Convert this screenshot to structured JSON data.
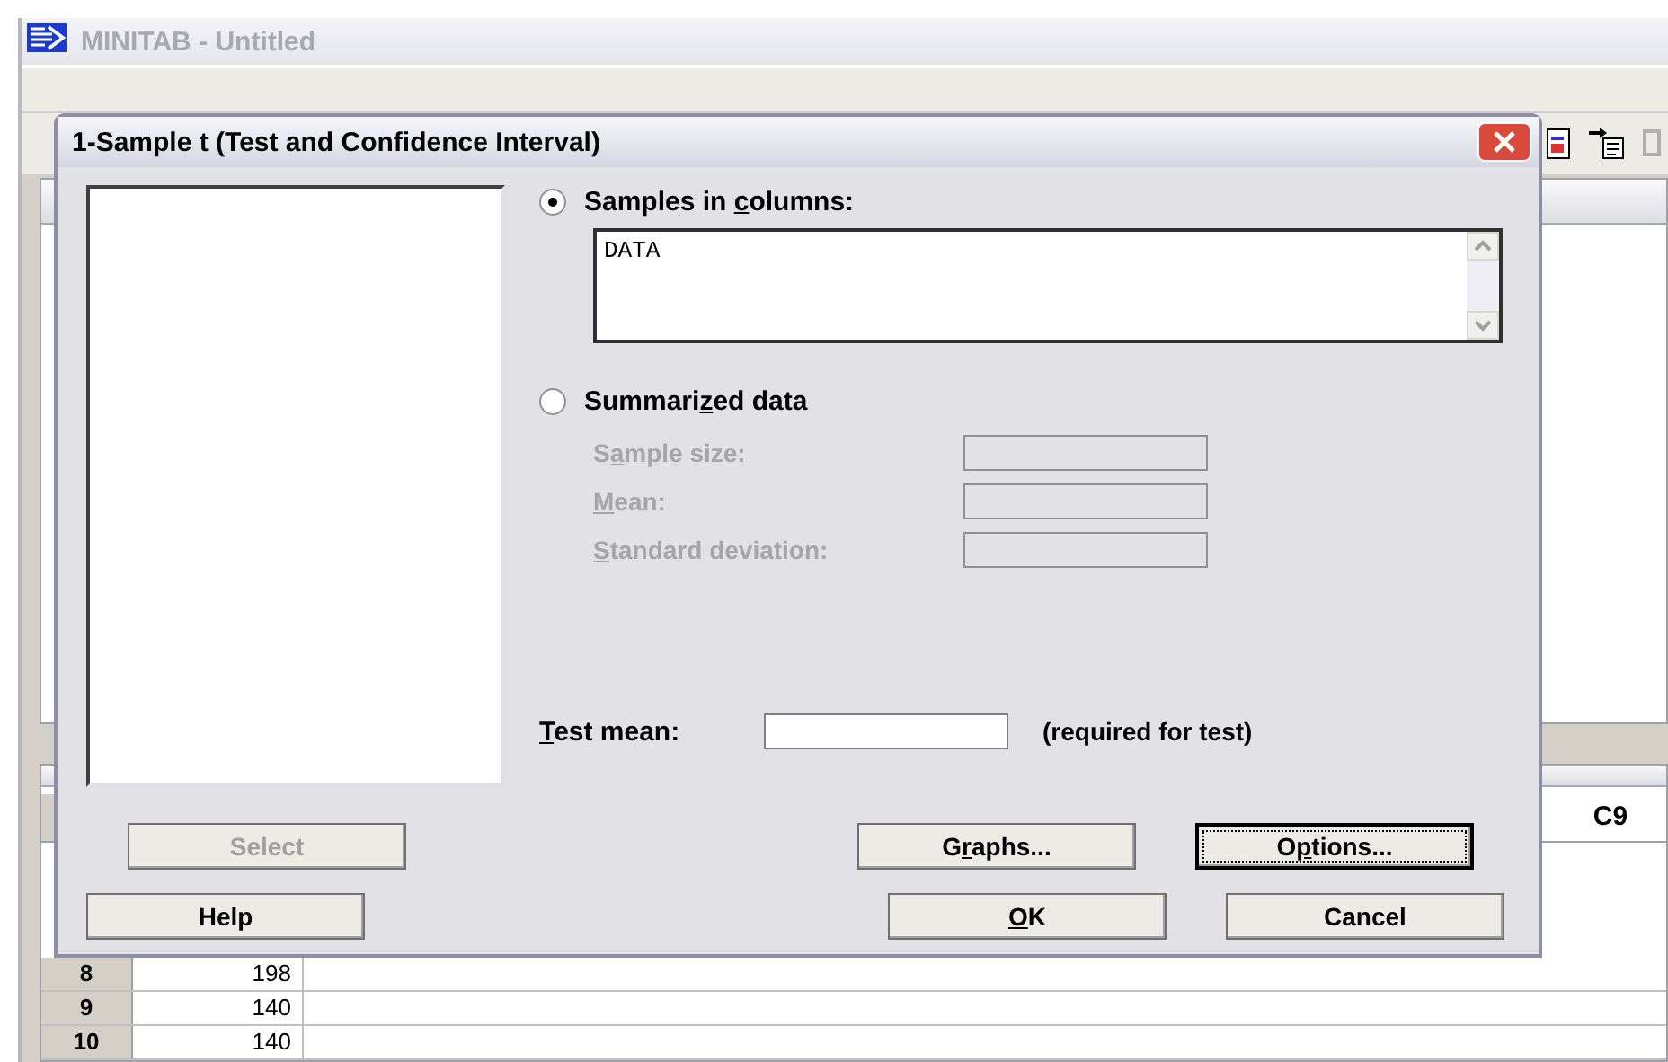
{
  "app": {
    "title": "MINITAB - Untitled"
  },
  "worksheet": {
    "visible_column_header": "C9",
    "rows": [
      {
        "number": "8",
        "value": "198"
      },
      {
        "number": "9",
        "value": "140"
      },
      {
        "number": "10",
        "value": "140"
      }
    ]
  },
  "dialog": {
    "title": "1-Sample t (Test and Confidence Interval)",
    "sources": [
      {
        "label": {
          "pre": "Samples in ",
          "key": "c",
          "post": "olumns:"
        },
        "selected": true,
        "kind": "columns",
        "value": "DATA"
      },
      {
        "label": {
          "pre": "Summari",
          "key": "z",
          "post": "ed data"
        },
        "selected": false,
        "kind": "summary"
      }
    ],
    "summary_fields": [
      {
        "label": {
          "pre": "S",
          "key": "a",
          "post": "mple size:"
        },
        "disabled": true
      },
      {
        "label": {
          "key": "M",
          "post": "ean:"
        },
        "disabled": true
      },
      {
        "label": {
          "key": "S",
          "post": "tandard deviation:"
        },
        "disabled": true
      }
    ],
    "test_mean": {
      "label": {
        "key": "T",
        "post": "est mean:"
      },
      "note": "(required for test)"
    },
    "buttons": [
      {
        "label": {
          "pre": "Select"
        },
        "disabled": true,
        "focused": false
      },
      {
        "label": {
          "pre": "G",
          "key": "r",
          "post": "aphs..."
        },
        "disabled": false,
        "focused": false
      },
      {
        "label": {
          "pre": "O",
          "key": "p",
          "post": "tions..."
        },
        "disabled": false,
        "focused": true
      },
      {
        "label": {
          "pre": "Help"
        },
        "disabled": false,
        "focused": false
      },
      {
        "label": {
          "key": "O",
          "post": "K"
        },
        "disabled": false,
        "focused": false
      },
      {
        "label": {
          "pre": "Cancel"
        },
        "disabled": false,
        "focused": false
      }
    ]
  }
}
